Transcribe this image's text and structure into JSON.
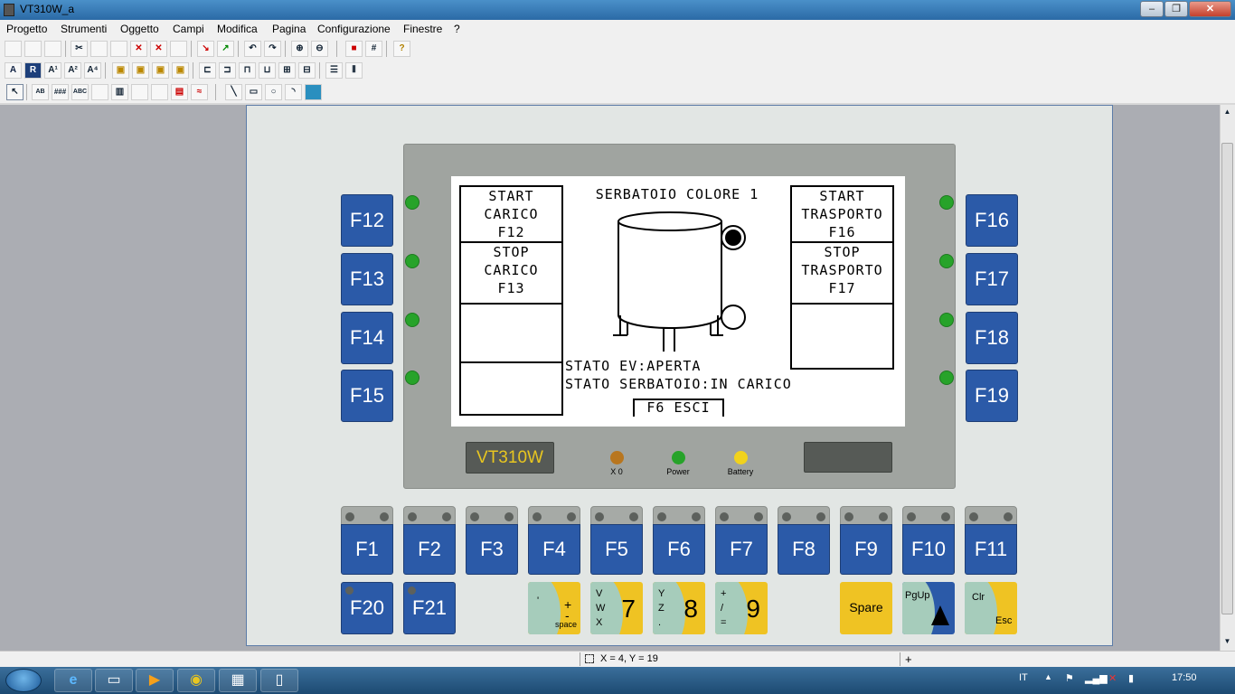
{
  "window": {
    "title": "VT310W_a"
  },
  "menu": [
    "Progetto",
    "Strumenti",
    "Oggetto",
    "Campi",
    "Modifica",
    "Pagina",
    "Configurazione",
    "Finestre",
    "?"
  ],
  "lcd": {
    "title": "SERBATOIO COLORE 1",
    "left_buttons": [
      [
        "START",
        "CARICO",
        "F12"
      ],
      [
        "STOP",
        "CARICO",
        "F13"
      ]
    ],
    "right_buttons": [
      [
        "START",
        "TRASPORTO",
        "F16"
      ],
      [
        "STOP",
        "TRASPORTO",
        "F17"
      ]
    ],
    "status_ev": "STATO EV:APERTA",
    "status_tank": "STATO SERBATOIO:IN CARICO",
    "exit_button": "F6 ESCI"
  },
  "device": {
    "model": "VT310W",
    "leds": {
      "x0": "X 0",
      "power": "Power",
      "battery": "Battery"
    },
    "led_colors": {
      "x0": "#b8761f",
      "power": "#27a32a",
      "battery": "#f1d21c"
    }
  },
  "keys": {
    "left": [
      "F12",
      "F13",
      "F14",
      "F15"
    ],
    "right": [
      "F16",
      "F17",
      "F18",
      "F19"
    ],
    "bottom": [
      "F1",
      "F2",
      "F3",
      "F4",
      "F5",
      "F6",
      "F7",
      "F8",
      "F9",
      "F10",
      "F11"
    ],
    "f20": "F20",
    "f21": "F21",
    "spare": "Spare",
    "pgup": "PgUp",
    "clr": "Clr",
    "esc": "Esc",
    "k_space": {
      "tl": "'",
      "tr": "+",
      "mid": "-",
      "bot": "space"
    },
    "k7": {
      "big": "7",
      "letters": [
        "V",
        "W",
        "X"
      ]
    },
    "k8": {
      "big": "8",
      "letters": [
        "Y",
        "Z",
        "."
      ]
    },
    "k9": {
      "big": "9",
      "letters": [
        "+",
        "/",
        "="
      ]
    }
  },
  "statusbar": {
    "coords": "X = 4, Y = 19"
  },
  "taskbar": {
    "lang": "IT",
    "time": "17:50"
  }
}
